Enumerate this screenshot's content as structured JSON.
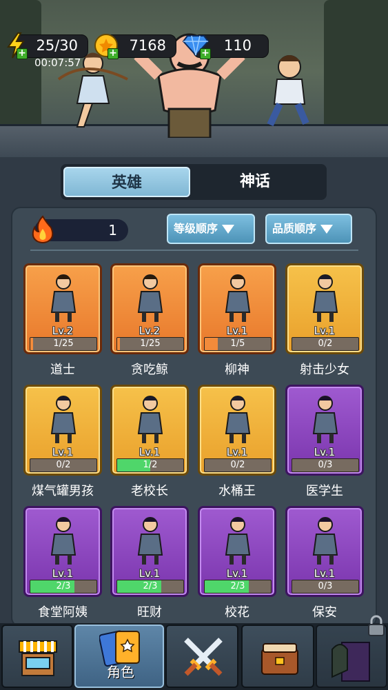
{
  "resources": {
    "energy": "25/30",
    "timer": "00:07:57",
    "coins": "7168",
    "gems": "110"
  },
  "tabs": {
    "heroes": "英雄",
    "myths": "神话"
  },
  "filters": {
    "fire_count": "1",
    "sort_level": "等级顺序",
    "sort_quality": "品质顺序"
  },
  "heroes": [
    {
      "name": "道士",
      "level": "Lv.2",
      "progress": "1/25",
      "fraction": 0.04,
      "rarity": "orange"
    },
    {
      "name": "贪吃鲸",
      "level": "Lv.2",
      "progress": "1/25",
      "fraction": 0.04,
      "rarity": "orange"
    },
    {
      "name": "柳神",
      "level": "Lv.1",
      "progress": "1/5",
      "fraction": 0.2,
      "rarity": "orange"
    },
    {
      "name": "射击少女",
      "level": "Lv.1",
      "progress": "0/2",
      "fraction": 0.0,
      "rarity": "yellow"
    },
    {
      "name": "煤气罐男孩",
      "level": "Lv.1",
      "progress": "0/2",
      "fraction": 0.0,
      "rarity": "yellow"
    },
    {
      "name": "老校长",
      "level": "Lv.1",
      "progress": "1/2",
      "fraction": 0.5,
      "rarity": "yellow"
    },
    {
      "name": "水桶王",
      "level": "Lv.1",
      "progress": "0/2",
      "fraction": 0.0,
      "rarity": "yellow"
    },
    {
      "name": "医学生",
      "level": "Lv.1",
      "progress": "0/3",
      "fraction": 0.0,
      "rarity": "purple"
    },
    {
      "name": "食堂阿姨",
      "level": "Lv.1",
      "progress": "2/3",
      "fraction": 0.667,
      "rarity": "purple"
    },
    {
      "name": "旺财",
      "level": "Lv.1",
      "progress": "2/3",
      "fraction": 0.667,
      "rarity": "purple"
    },
    {
      "name": "校花",
      "level": "Lv.1",
      "progress": "2/3",
      "fraction": 0.667,
      "rarity": "purple"
    },
    {
      "name": "保安",
      "level": "Lv.1",
      "progress": "0/3",
      "fraction": 0.0,
      "rarity": "purple"
    }
  ],
  "nav": {
    "shop_icon": "shop-stall-icon",
    "characters_label": "角色",
    "battle_icon": "crossed-swords-icon",
    "book_icon": "book-icon",
    "locked_icon": "door-lock-icon"
  },
  "colors": {
    "orange_card": "#e8782b",
    "yellow_card": "#e9a02b",
    "purple_card": "#7a35ad",
    "progress_orange": "#f28b3b",
    "progress_green": "#4fd66a"
  }
}
